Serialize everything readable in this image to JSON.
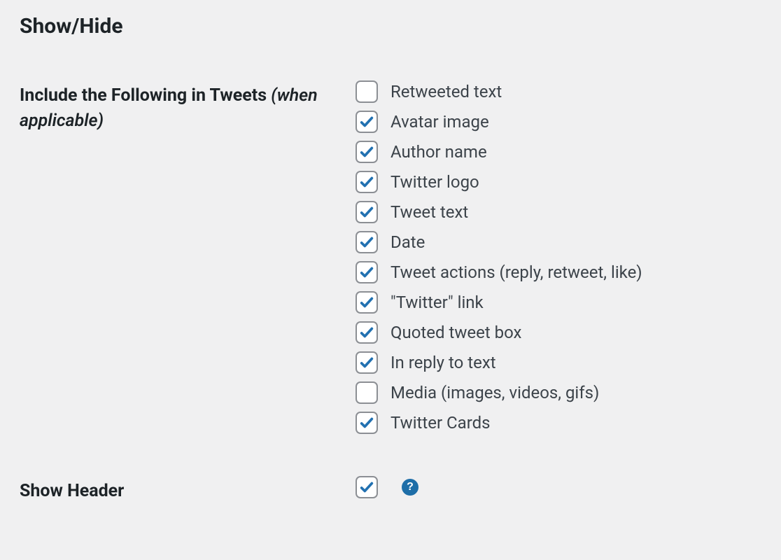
{
  "section_title": "Show/Hide",
  "include_row": {
    "label_main": "Include the Following in Tweets ",
    "label_sub": "(when applicable)"
  },
  "checkboxes": [
    {
      "label": "Retweeted text",
      "checked": false
    },
    {
      "label": "Avatar image",
      "checked": true
    },
    {
      "label": "Author name",
      "checked": true
    },
    {
      "label": "Twitter logo",
      "checked": true
    },
    {
      "label": "Tweet text",
      "checked": true
    },
    {
      "label": "Date",
      "checked": true
    },
    {
      "label": "Tweet actions (reply, retweet, like)",
      "checked": true
    },
    {
      "label": "\"Twitter\" link",
      "checked": true
    },
    {
      "label": "Quoted tweet box",
      "checked": true
    },
    {
      "label": "In reply to text",
      "checked": true
    },
    {
      "label": "Media (images, videos, gifs)",
      "checked": false
    },
    {
      "label": "Twitter Cards",
      "checked": true
    }
  ],
  "show_header": {
    "label": "Show Header",
    "checked": true
  },
  "help_glyph": "?"
}
